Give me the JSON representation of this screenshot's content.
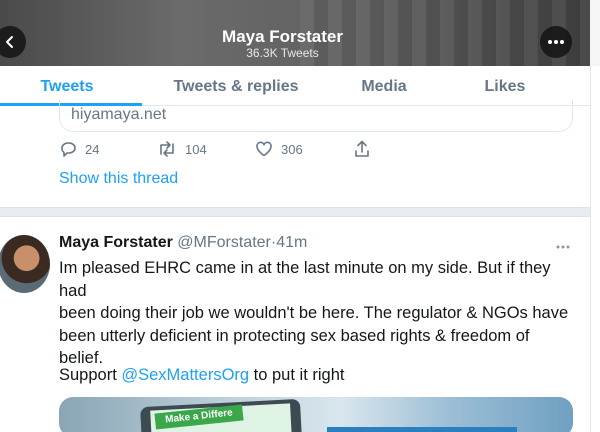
{
  "header": {
    "title": "Maya Forstater",
    "subtitle": "36.3K Tweets"
  },
  "tabs": [
    {
      "label": "Tweets",
      "active": true
    },
    {
      "label": "Tweets & replies",
      "active": false
    },
    {
      "label": "Media",
      "active": false
    },
    {
      "label": "Likes",
      "active": false
    }
  ],
  "previous_tweet": {
    "link_text": "hiyamaya.net",
    "replies": "24",
    "retweets": "104",
    "likes": "306",
    "show_thread": "Show this thread"
  },
  "tweet": {
    "author_name": "Maya Forstater",
    "author_handle": "@MForstater",
    "separator": "·",
    "time": "41m",
    "lines": [
      "Im pleased EHRC came in at the last minute on my side. But if they had",
      "been doing their job we wouldn't be here. The regulator & NGOs have",
      "been utterly deficient in protecting sex based rights & freedom of",
      "belief."
    ],
    "support_prefix": "Support ",
    "mention": "@SexMattersOrg",
    "support_suffix": " to put it right",
    "media_badge": "Make a Differe"
  },
  "colors": {
    "accent": "#1da1f2",
    "muted": "#657786",
    "text": "#14171a"
  }
}
